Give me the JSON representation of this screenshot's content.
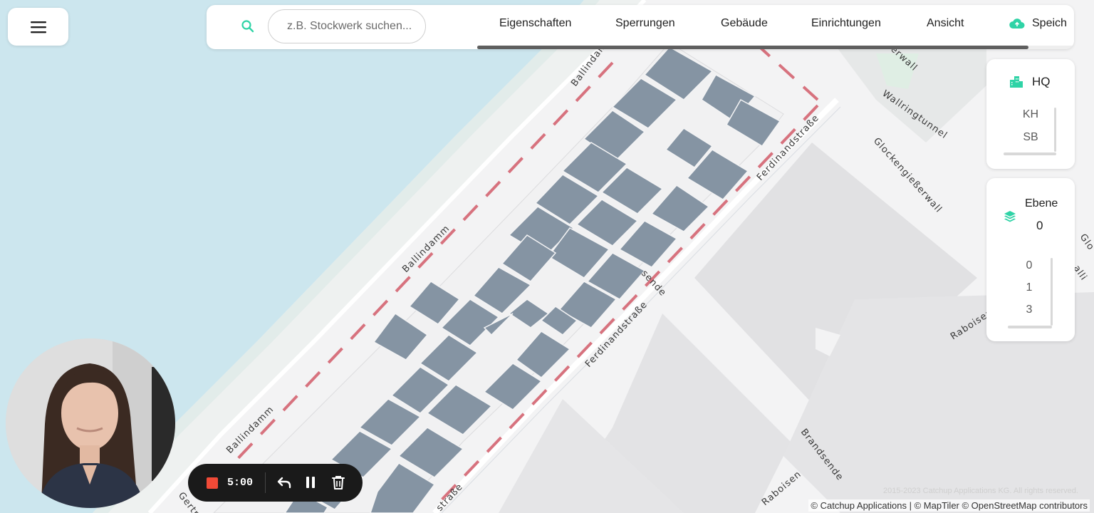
{
  "search": {
    "placeholder": "z.B. Stockwerk suchen..."
  },
  "nav_tabs": [
    "Eigenschaften",
    "Sperrungen",
    "Gebäude",
    "Einrichtungen",
    "Ansicht"
  ],
  "save_label": "Speich",
  "buildings": {
    "title": "HQ",
    "items": [
      "KH",
      "SB"
    ]
  },
  "levels": {
    "title": "Ebene",
    "current": "0",
    "items": [
      "0",
      "1",
      "3"
    ]
  },
  "streets": {
    "ballindamm_1": "Ballindamm",
    "ballindamm_2": "Ballindamm",
    "ballindamm_3": "Ballindamm",
    "ferdinandstrasse_1": "Ferdinandstraße",
    "ferdinandstrasse_2": "Ferdinandstraße",
    "ferdinandstrasse_3": "straße",
    "sende": "sende",
    "wallringtunnel": "Wallringtunnel",
    "glockengiesserwall": "Glockengießerwall",
    "erwall": "erwall",
    "raboisen_1": "Raboisen",
    "raboisen_2": "Raboisen",
    "brandsende": "Brandsende",
    "gertrud": "Gertru",
    "glo_edge": "Glo",
    "alli_edge": "alli"
  },
  "recorder": {
    "time": "5:00"
  },
  "attribution": {
    "copyright_faint": "2015-2023 Catchup Applications KG. All rights reserved.",
    "credits": "© Catchup Applications | © MapTiler © OpenStreetMap contributors"
  },
  "colors": {
    "accent": "#2fd3a6",
    "water": "#cce6ee",
    "building_indoor": "#8594a3",
    "restricted_line": "#d7727e",
    "recorder_bg": "#1a1a1a",
    "record_red": "#f04a37"
  }
}
